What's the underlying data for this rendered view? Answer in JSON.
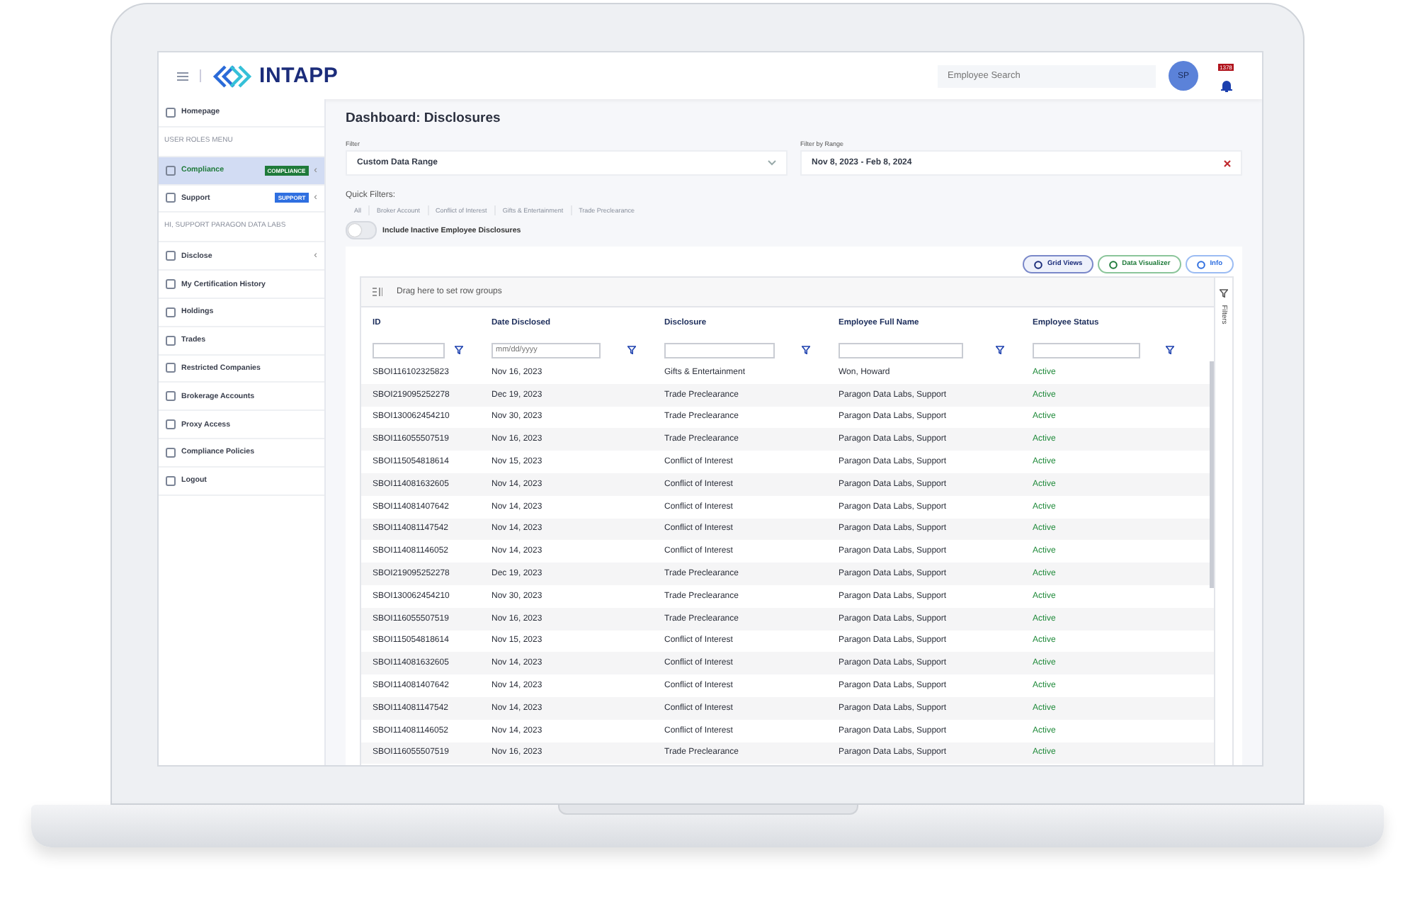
{
  "header": {
    "brand": "INTAPP",
    "search": {
      "placeholder": "Employee Search"
    },
    "avatar": "SP",
    "notification_count": "1378"
  },
  "sidebar": {
    "items": [
      {
        "kind": "item",
        "label": "Homepage",
        "selected": false
      },
      {
        "kind": "section",
        "label": "USER ROLES MENU"
      },
      {
        "kind": "item",
        "label": "Compliance",
        "selected": true,
        "badge": "COMPLIANCE",
        "color": "#1f7a3a",
        "chevron": "‹"
      },
      {
        "kind": "item",
        "label": "Support",
        "selected": false,
        "badge": "SUPPORT",
        "color": "#2f6fe0",
        "chevron": "‹"
      },
      {
        "kind": "section",
        "label": "HI, SUPPORT PARAGON DATA LABS"
      },
      {
        "kind": "item",
        "label": "Disclose",
        "selected": false,
        "chevron": "‹"
      },
      {
        "kind": "item",
        "label": "My Certification History",
        "selected": false
      },
      {
        "kind": "item",
        "label": "Holdings",
        "selected": false
      },
      {
        "kind": "item",
        "label": "Trades",
        "selected": false
      },
      {
        "kind": "item",
        "label": "Restricted Companies",
        "selected": false
      },
      {
        "kind": "item",
        "label": "Brokerage Accounts",
        "selected": false
      },
      {
        "kind": "item",
        "label": "Proxy Access",
        "selected": false
      },
      {
        "kind": "item",
        "label": "Compliance Policies",
        "selected": false
      },
      {
        "kind": "item",
        "label": "Logout",
        "selected": false
      }
    ]
  },
  "page_title": "Dashboard: Disclosures",
  "filter": {
    "label": "Filter",
    "value": "Custom Data Range"
  },
  "range": {
    "label": "Filter by Range",
    "value": "Nov 8, 2023 - Feb 8, 2024"
  },
  "quick_filters": {
    "label": "Quick Filters:",
    "items": [
      "All",
      "Broker Account",
      "Conflict of Interest",
      "Gifts & Entertainment",
      "Trade Preclearance"
    ]
  },
  "toggle": {
    "label": "Include Inactive Employee Disclosures",
    "on": false
  },
  "buttons": [
    "Grid Views",
    "Data Visualizer",
    "Info"
  ],
  "grid": {
    "group_hint": "Drag here to set row groups",
    "side_panel": "Filters",
    "date_placeholder": "mm/dd/yyyy",
    "columns": [
      "ID",
      "Date Disclosed",
      "Disclosure",
      "Employee Full Name",
      "Employee Status"
    ],
    "rows": [
      [
        "SBOI116102325823",
        "Nov 16, 2023",
        "Gifts & Entertainment",
        "Won, Howard",
        "Active"
      ],
      [
        "SBOI219095252278",
        "Dec 19, 2023",
        "Trade Preclearance",
        "Paragon Data Labs, Support",
        "Active"
      ],
      [
        "SBOI130062454210",
        "Nov 30, 2023",
        "Trade Preclearance",
        "Paragon Data Labs, Support",
        "Active"
      ],
      [
        "SBOI116055507519",
        "Nov 16, 2023",
        "Trade Preclearance",
        "Paragon Data Labs, Support",
        "Active"
      ],
      [
        "SBOI115054818614",
        "Nov 15, 2023",
        "Conflict of Interest",
        "Paragon Data Labs, Support",
        "Active"
      ],
      [
        "SBOI114081632605",
        "Nov 14, 2023",
        "Conflict of Interest",
        "Paragon Data Labs, Support",
        "Active"
      ],
      [
        "SBOI114081407642",
        "Nov 14, 2023",
        "Conflict of Interest",
        "Paragon Data Labs, Support",
        "Active"
      ],
      [
        "SBOI114081147542",
        "Nov 14, 2023",
        "Conflict of Interest",
        "Paragon Data Labs, Support",
        "Active"
      ],
      [
        "SBOI114081146052",
        "Nov 14, 2023",
        "Conflict of Interest",
        "Paragon Data Labs, Support",
        "Active"
      ],
      [
        "SBOI219095252278",
        "Dec 19, 2023",
        "Trade Preclearance",
        "Paragon Data Labs, Support",
        "Active"
      ],
      [
        "SBOI130062454210",
        "Nov 30, 2023",
        "Trade Preclearance",
        "Paragon Data Labs, Support",
        "Active"
      ],
      [
        "SBOI116055507519",
        "Nov 16, 2023",
        "Trade Preclearance",
        "Paragon Data Labs, Support",
        "Active"
      ],
      [
        "SBOI115054818614",
        "Nov 15, 2023",
        "Conflict of Interest",
        "Paragon Data Labs, Support",
        "Active"
      ],
      [
        "SBOI114081632605",
        "Nov 14, 2023",
        "Conflict of Interest",
        "Paragon Data Labs, Support",
        "Active"
      ],
      [
        "SBOI114081407642",
        "Nov 14, 2023",
        "Conflict of Interest",
        "Paragon Data Labs, Support",
        "Active"
      ],
      [
        "SBOI114081147542",
        "Nov 14, 2023",
        "Conflict of Interest",
        "Paragon Data Labs, Support",
        "Active"
      ],
      [
        "SBOI114081146052",
        "Nov 14, 2023",
        "Conflict of Interest",
        "Paragon Data Labs, Support",
        "Active"
      ],
      [
        "SBOI116055507519",
        "Nov 16, 2023",
        "Trade Preclearance",
        "Paragon Data Labs, Support",
        "Active"
      ]
    ]
  }
}
